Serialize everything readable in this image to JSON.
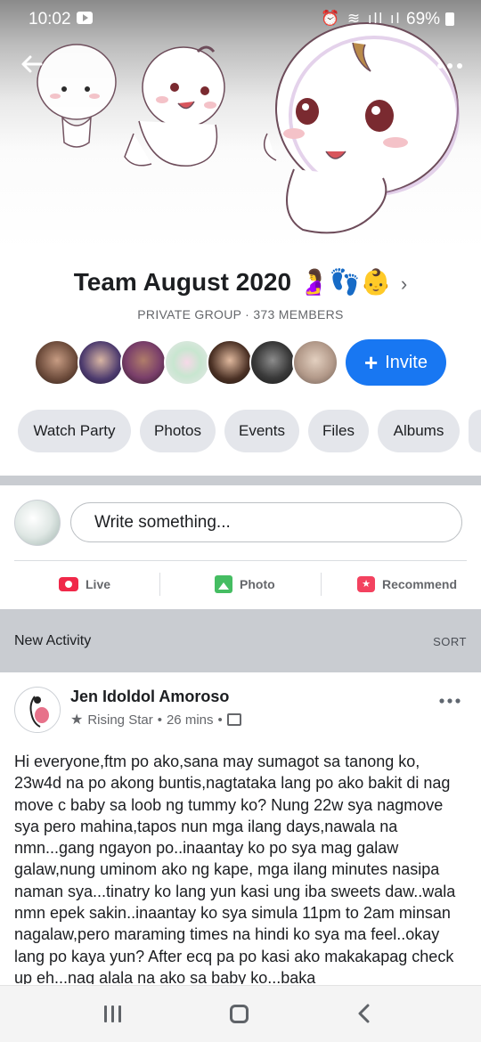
{
  "status_bar": {
    "time": "10:02",
    "battery": "69%"
  },
  "cover": {
    "icons": {
      "back": "back-arrow-icon",
      "search": "search-icon",
      "more": "more-icon"
    }
  },
  "group": {
    "name": "Team August 2020 🤰👣👶",
    "meta": "PRIVATE GROUP · 373 MEMBERS",
    "invite_label": "Invite"
  },
  "tabs": [
    "Watch Party",
    "Photos",
    "Events",
    "Files",
    "Albums"
  ],
  "composer": {
    "placeholder": "Write something...",
    "actions": {
      "live": "Live",
      "photo": "Photo",
      "recommend": "Recommend"
    }
  },
  "activity_bar": {
    "title": "New Activity",
    "sort": "SORT"
  },
  "post": {
    "author": "Jen Idoldol Amoroso",
    "badge": "Rising Star",
    "time": "26 mins",
    "body": "Hi everyone,ftm po ako,sana may sumagot sa tanong ko, 23w4d na po akong buntis,nagtataka lang po ako bakit di nag move c baby sa loob ng tummy ko? Nung 22w sya nagmove sya pero mahina,tapos nun mga ilang days,nawala na nmn...gang ngayon po..inaantay ko po sya mag galaw galaw,nung uminom ako ng kape, mga ilang minutes nasipa naman sya...tinatry ko lang yun kasi ung iba sweets daw..wala nmn epek sakin..inaantay ko sya simula 11pm to 2am minsan nagalaw,pero maraming times na hindi ko sya ma feel..okay lang po kaya yun? After ecq pa po kasi ako makakapag check up eh...nag alala na ako sa baby ko...baka"
  },
  "colors": {
    "accent": "#1877f2",
    "band": "#c9ccd1",
    "chip": "#e4e6eb"
  }
}
